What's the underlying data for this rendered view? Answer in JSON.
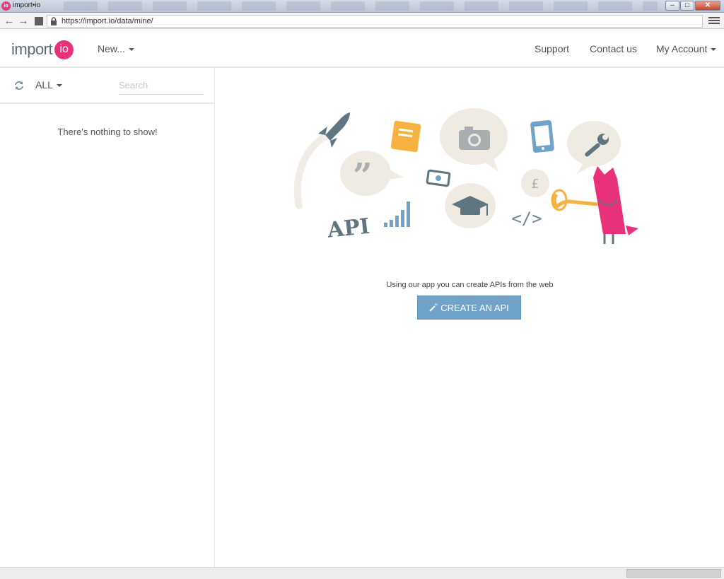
{
  "window": {
    "favicon_text": "io",
    "title": "import•io",
    "minimize": "–",
    "maximize": "□",
    "close": "✕"
  },
  "browser": {
    "back_icon": "←",
    "forward_icon": "→",
    "stop_icon": "stop-icon",
    "url": "https://import.io/data/mine/"
  },
  "header": {
    "logo_word": "import",
    "logo_circle": "io",
    "new_label": "New...",
    "support_label": "Support",
    "contact_label": "Contact us",
    "account_label": "My Account"
  },
  "sidebar": {
    "filter_label": "ALL",
    "search_placeholder": "Search",
    "search_value": "",
    "empty_message": "There's nothing to show!"
  },
  "main": {
    "illustration_api_text": "API",
    "illustration_pound_text": "£",
    "illustration_code_text": "</>",
    "tagline": "Using our app you can create APIs from the web",
    "create_button_label": "CREATE AN API"
  },
  "colors": {
    "brand_pink": "#e8317a",
    "button_blue": "#6fa3c9",
    "logo_gray": "#5c6c72",
    "bubble_beige": "#efebe3",
    "icon_slate": "#5f7580"
  }
}
